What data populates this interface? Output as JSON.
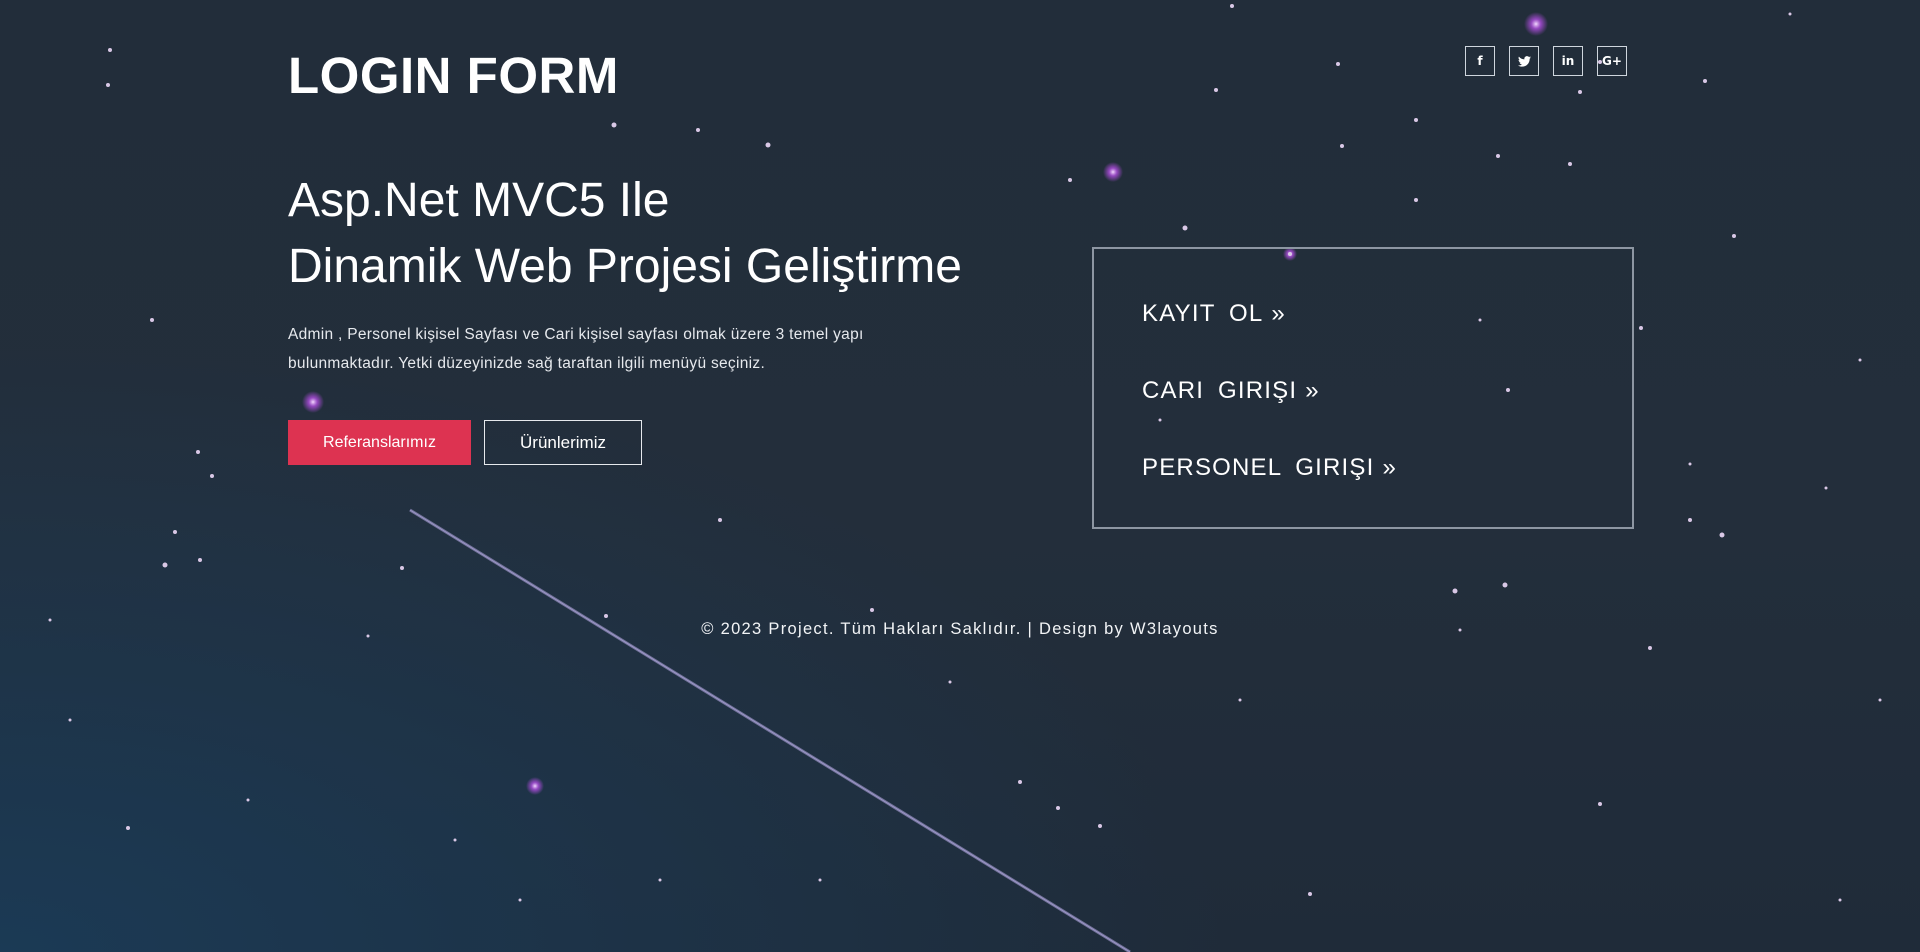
{
  "header": {
    "logo": "LOGIN FORM",
    "social": [
      {
        "icon": "facebook-icon",
        "glyph": "f"
      },
      {
        "icon": "twitter-icon",
        "glyph": "🐦"
      },
      {
        "icon": "linkedin-icon",
        "glyph": "in"
      },
      {
        "icon": "google-plus-icon",
        "glyph": "G+"
      }
    ]
  },
  "hero": {
    "title_line1": "Asp.Net MVC5 Ile",
    "title_line2": "Dinamik Web Projesi Geliştirme",
    "description": "Admin , Personel kişisel Sayfası ve Cari kişisel sayfası olmak üzere 3 temel yapı bulunmaktadır. Yetki düzeyinizde sağ taraftan ilgili menüyü seçiniz.",
    "primary_button": "Referanslarımız",
    "secondary_button": "Ürünlerimiz"
  },
  "login_menu": {
    "items": [
      {
        "label": "KAYIT OL",
        "arrow": "»"
      },
      {
        "label": "CARI GIRIŞI",
        "arrow": "»"
      },
      {
        "label": "PERSONEL GIRIŞI",
        "arrow": "»"
      }
    ]
  },
  "footer": {
    "text": "© 2023 Project. Tüm Hakları Saklıdır. | Design by W3layouts"
  },
  "colors": {
    "background": "#232e3b",
    "accent_button": "#dd3351",
    "box_border": "#8d96a2"
  }
}
